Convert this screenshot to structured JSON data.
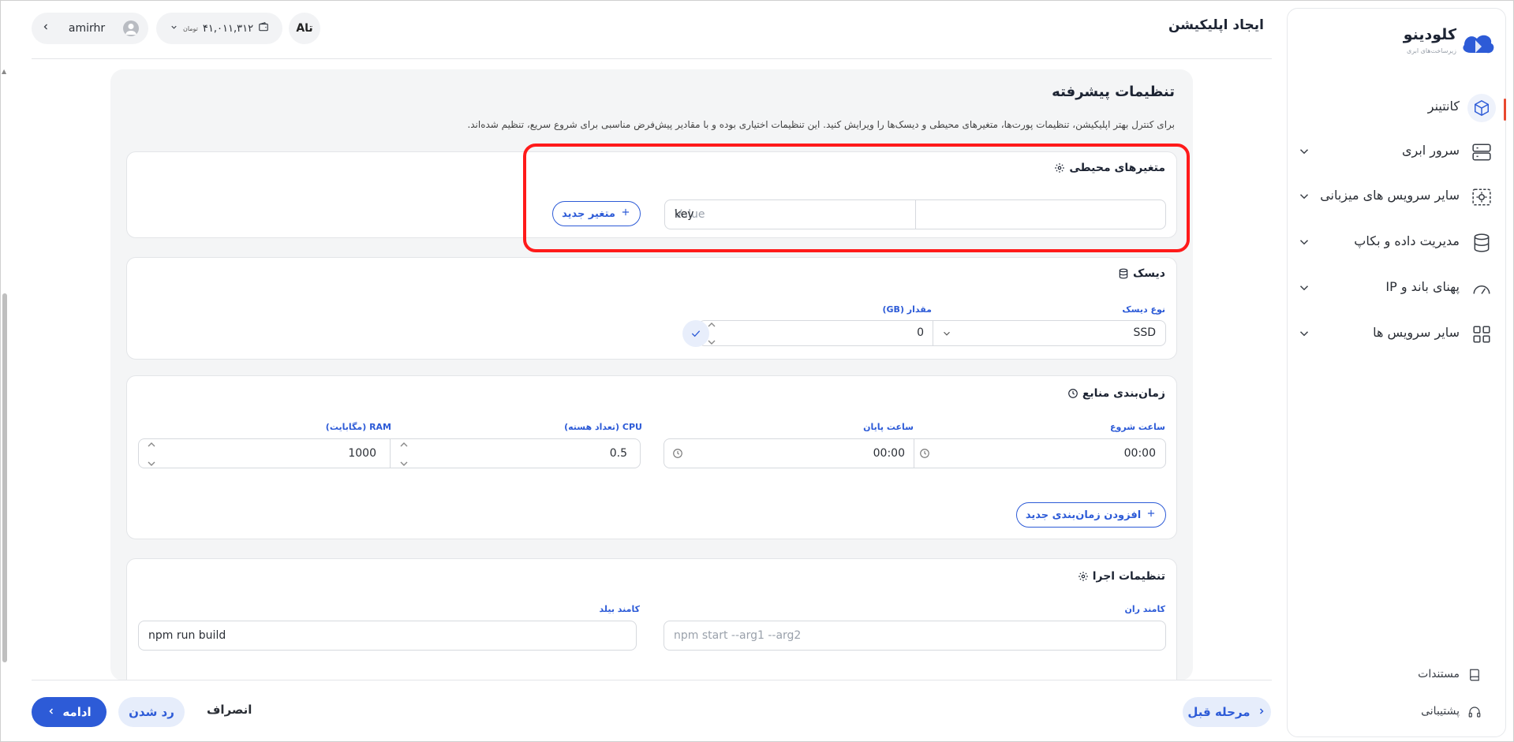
{
  "app": {
    "logo_text": "کلودینو",
    "logo_sub": "زیرساخت‌های ابری",
    "brand_colors": {
      "primary": "#2d5bd7",
      "accent": "#e8492f",
      "highlight": "#ff1a1a"
    }
  },
  "header": {
    "page_title": "ایجاد اپلیکیشن",
    "username": "amirhr",
    "wallet_amount": "۴۱,۰۱۱,۳۱۲",
    "wallet_unit": "تومان",
    "lang_label": "Aتا"
  },
  "sidebar": {
    "items": [
      {
        "label": "کانتینر",
        "icon": "container-icon",
        "active": true
      },
      {
        "label": "سرور ابری",
        "icon": "server-icon"
      },
      {
        "label": "سایر سرویس های میزبانی",
        "icon": "hosting-gear-icon"
      },
      {
        "label": "مدیریت داده و بکاپ",
        "icon": "database-icon"
      },
      {
        "label": "پهنای باند و IP",
        "icon": "gauge-icon"
      },
      {
        "label": "سایر سرویس ها",
        "icon": "grid-icon"
      }
    ],
    "footer": [
      {
        "label": "مستندات",
        "icon": "book-icon"
      },
      {
        "label": "پشتیبانی",
        "icon": "headset-icon"
      }
    ]
  },
  "main": {
    "title": "تنظیمات پیشرفته",
    "description": "برای کنترل بهتر اپلیکیشن، تنظیمات پورت‌ها، متغیرهای محیطی و دیسک‌ها را ویرایش کنید. این تنظیمات اختیاری بوده و با مقادیر پیش‌فرض مناسبی برای شروع سریع، تنظیم شده‌اند.",
    "env": {
      "title": "متغیرهای محیطی",
      "key_value": "key",
      "value_placeholder": "Value",
      "add_button": "متغیر جدید"
    },
    "disk": {
      "title": "دیسک",
      "type_label": "نوع دیسک",
      "type_value": "SSD",
      "amount_label": "مقدار (GB)",
      "amount_value": "0"
    },
    "schedule": {
      "title": "زمان‌بندی منابع",
      "start_label": "ساعت شروع",
      "start_value": "00:00",
      "end_label": "ساعت پایان",
      "end_value": "00:00",
      "cpu_label": "CPU (تعداد هسته)",
      "cpu_value": "0.5",
      "ram_label": "RAM (مگابایت)",
      "ram_value": "1000",
      "add_button": "افزودن زمان‌بندی جدید"
    },
    "run": {
      "title": "تنظیمات اجرا",
      "run_cmd_label": "کامند ران",
      "run_cmd_placeholder": "npm start --arg1 --arg2",
      "build_cmd_label": "کامند بیلد",
      "build_cmd_value": "npm run build"
    }
  },
  "footer": {
    "continue": "ادامه",
    "reject": "رد شدن",
    "cancel": "انصراف",
    "previous": "مرحله قبل"
  }
}
